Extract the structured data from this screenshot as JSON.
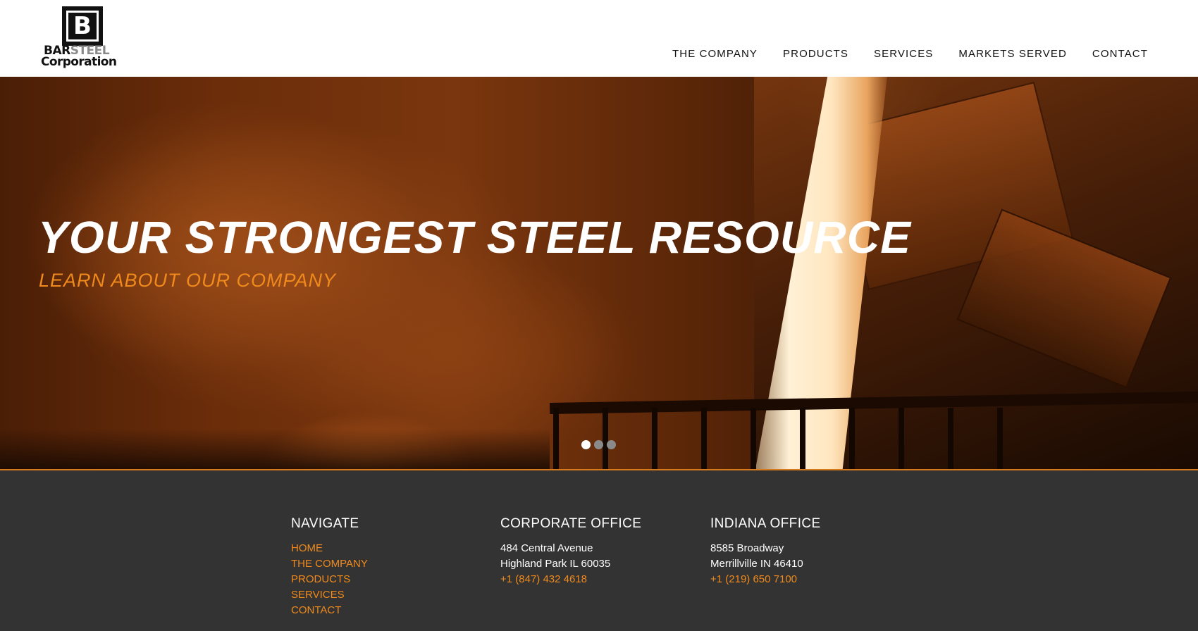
{
  "logo": {
    "letter": "B",
    "word_bar": "BAR",
    "word_steel": "STEEL",
    "word_corporation": "Corporation"
  },
  "nav": {
    "items": [
      {
        "label": "THE COMPANY"
      },
      {
        "label": "PRODUCTS"
      },
      {
        "label": "SERVICES"
      },
      {
        "label": "MARKETS SERVED"
      },
      {
        "label": "CONTACT"
      }
    ]
  },
  "hero": {
    "title": "YOUR STRONGEST STEEL RESOURCE",
    "link": "LEARN ABOUT OUR COMPANY",
    "slides_total": 3,
    "active_slide": 1
  },
  "footer": {
    "navigate": {
      "title": "NAVIGATE",
      "links": [
        {
          "label": "HOME"
        },
        {
          "label": "THE COMPANY"
        },
        {
          "label": "PRODUCTS"
        },
        {
          "label": "SERVICES"
        },
        {
          "label": "CONTACT"
        }
      ]
    },
    "corporate": {
      "title": "CORPORATE OFFICE",
      "address1": "484 Central Avenue",
      "address2": "Highland Park IL 60035",
      "phone": "+1 (847) 432 4618"
    },
    "indiana": {
      "title": "INDIANA OFFICE",
      "address1": "8585 Broadway",
      "address2": "Merrillville IN 46410",
      "phone": "+1 (219) 650 7100"
    }
  },
  "colors": {
    "accent": "#f08a1c",
    "footer_bg": "#333333",
    "header_bg": "#ffffff"
  }
}
